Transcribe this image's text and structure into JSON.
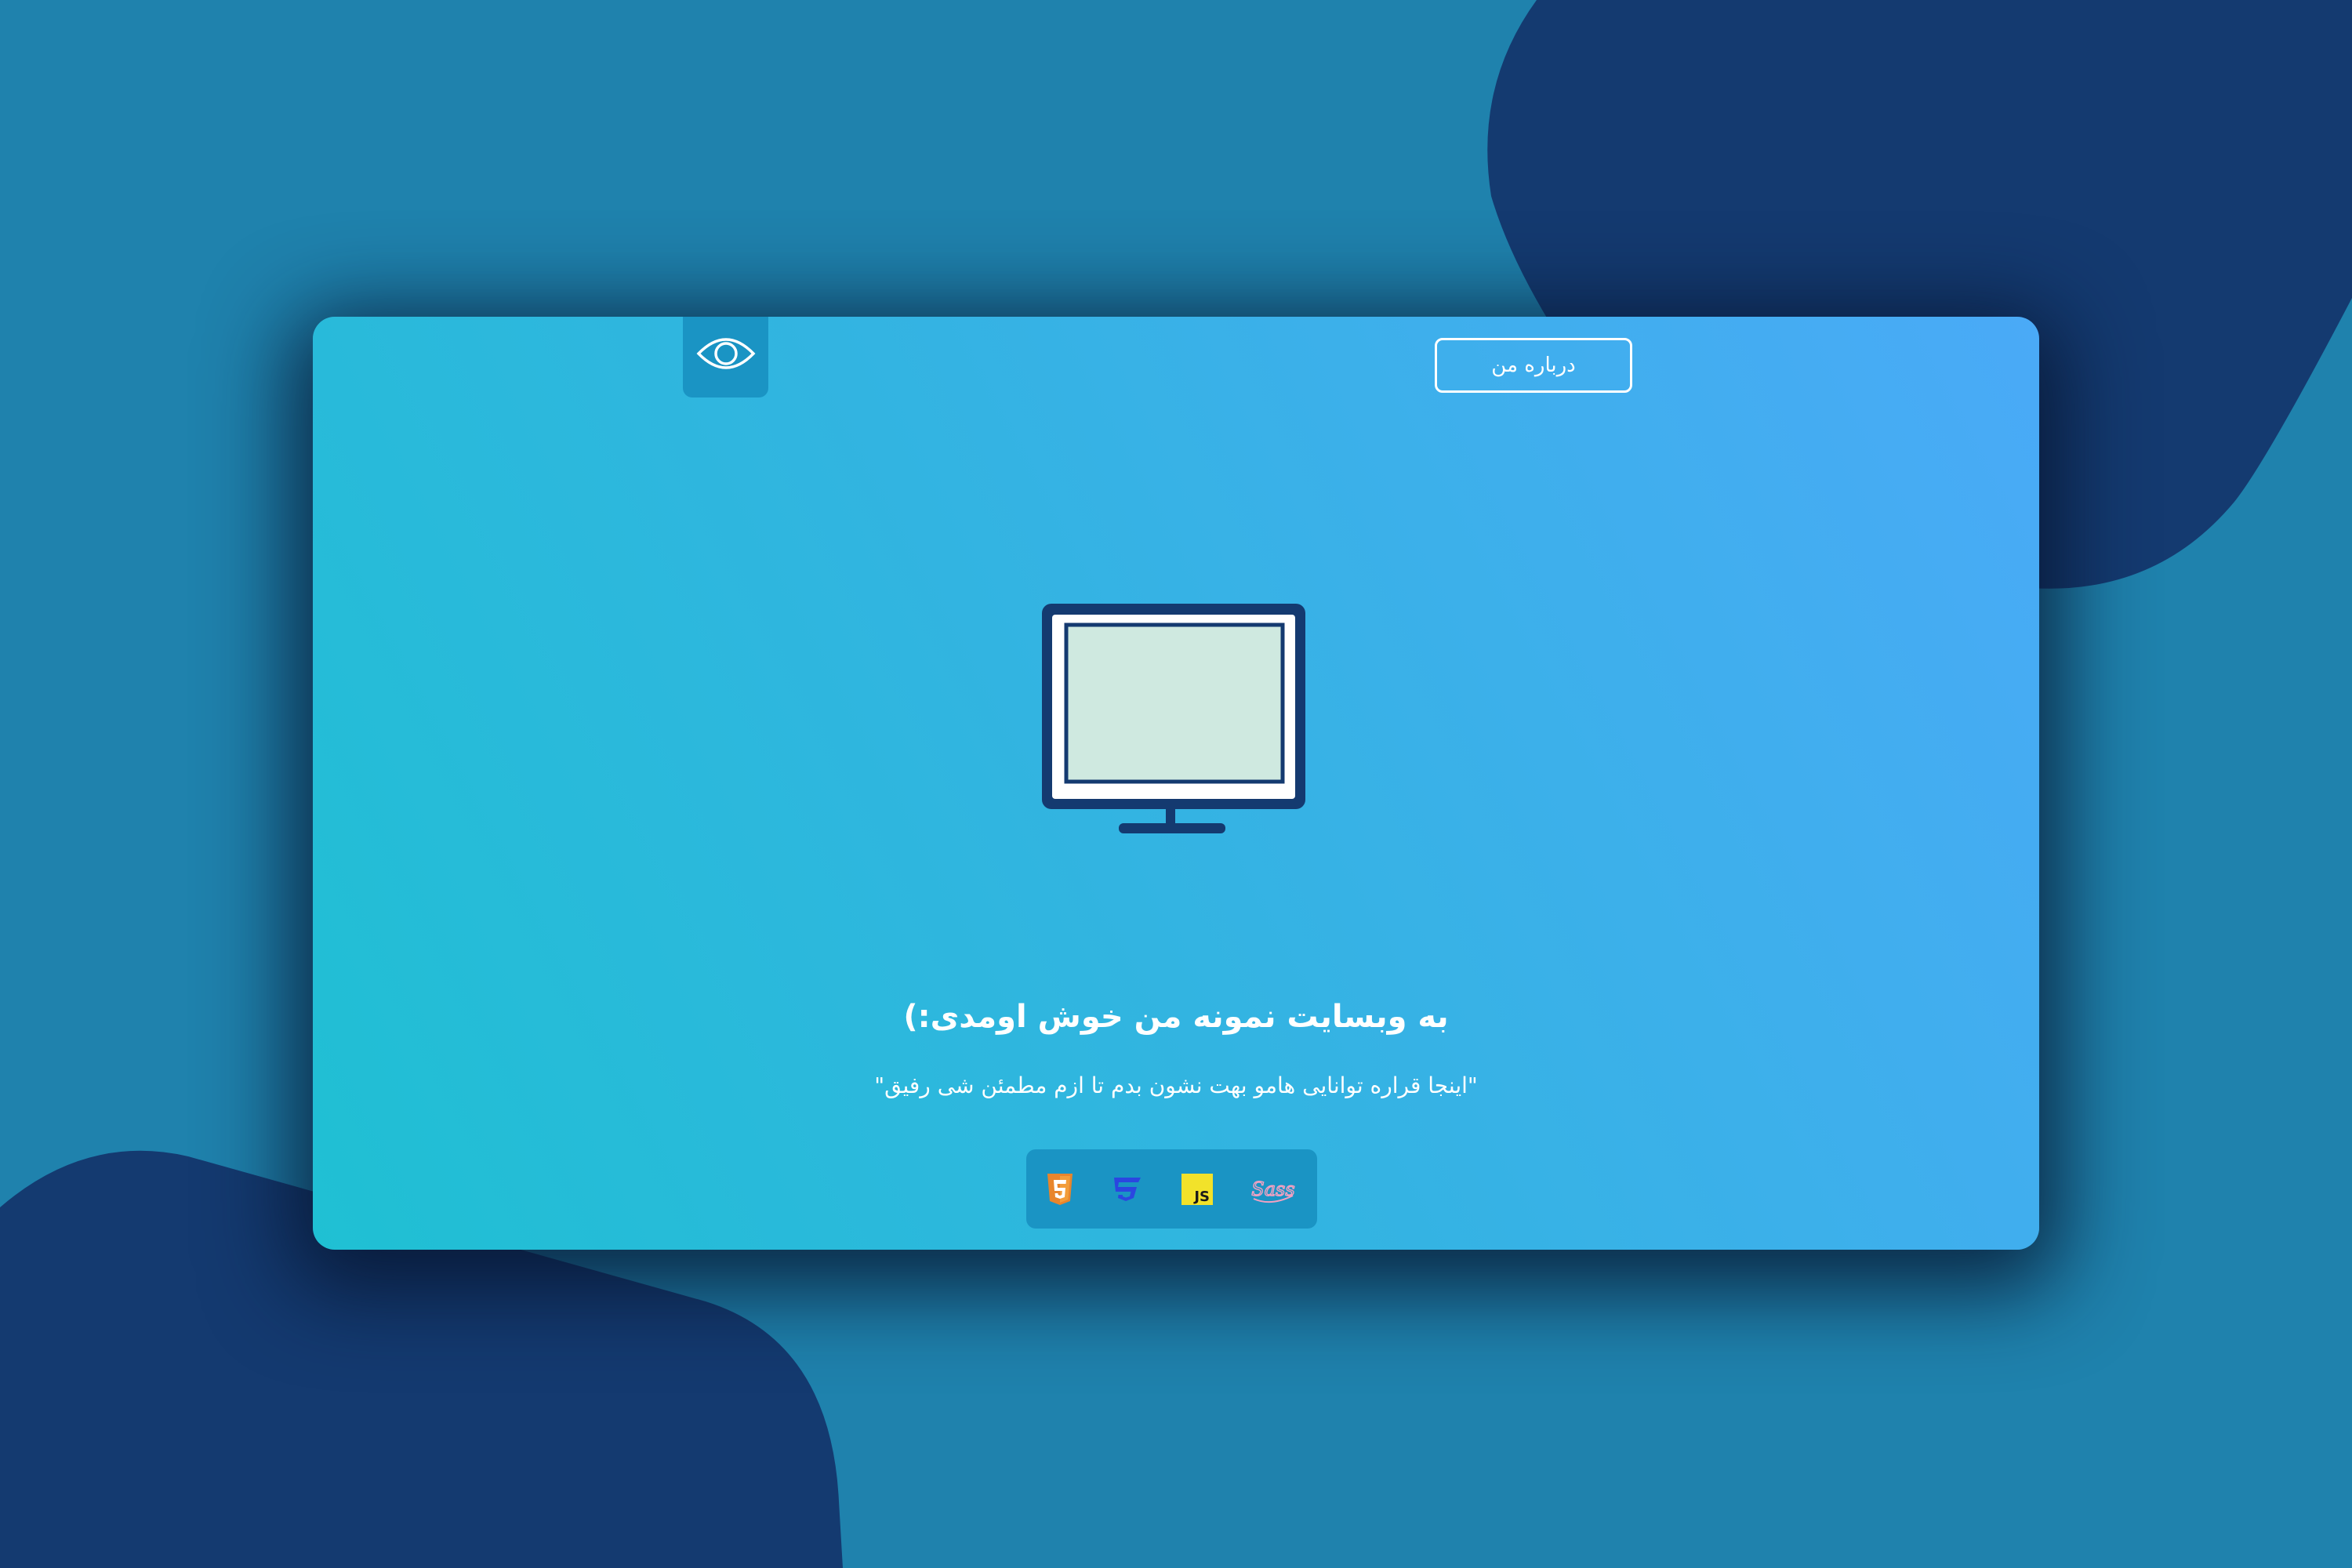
{
  "colors": {
    "background": "#1f82ad",
    "blob": "#143a70",
    "card_gradient_start": "#1fc0d3",
    "card_gradient_end": "#4aaaf7",
    "tab": "#1a94c4",
    "monitor_frame": "#143a70",
    "monitor_screen": "#cfe9e0"
  },
  "header": {
    "logo_icon": "eye-icon",
    "about_button_label": "درباره من"
  },
  "hero": {
    "illustration": "monitor-icon",
    "title": "به وبسایت نمونه من خوش اومدی:)",
    "subtitle": "\"اینجا قراره توانایی هامو بهت نشون بدم تا ازم مطمئن شی رفیق\""
  },
  "tech_stack": {
    "icons": [
      "html5-icon",
      "css3-icon",
      "javascript-icon",
      "sass-icon"
    ],
    "js_badge_text": "JS",
    "sass_text": "Sass"
  }
}
